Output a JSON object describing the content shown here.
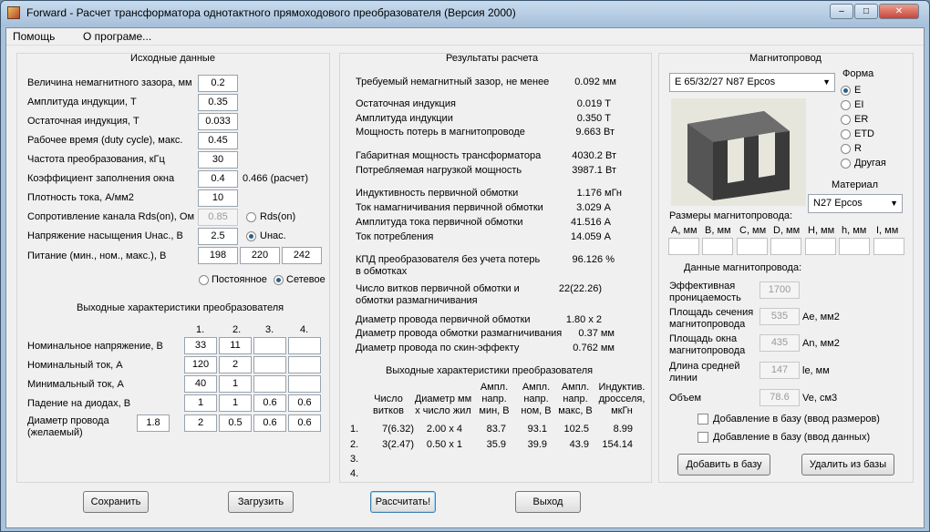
{
  "window": {
    "title": "Forward - Расчет трансформатора однотактного прямоходового преобразователя (Версия 2000)",
    "min_label": "–",
    "max_label": "□",
    "close_label": "✕"
  },
  "menu": {
    "help": "Помощь",
    "about": "О програме..."
  },
  "input": {
    "title": "Исходные данные",
    "rows": [
      {
        "label": "Величина немагнитного зазора, мм",
        "value": "0.2"
      },
      {
        "label": "Амплитуда индукции, Т",
        "value": "0.35"
      },
      {
        "label": "Остаточная индукция, Т",
        "value": "0.033"
      },
      {
        "label": "Рабочее время (duty cycle), макс.",
        "value": "0.45"
      },
      {
        "label": "Частота преобразования, кГц",
        "value": "30"
      },
      {
        "label": "Коэффициент заполнения окна",
        "value": "0.4"
      },
      {
        "label": "Плотность тока, А/мм2",
        "value": "10"
      },
      {
        "label": "Сопротивление канала Rds(on), Ом",
        "value": "0.85"
      },
      {
        "label": "Напряжение насыщения Uнас., В",
        "value": "2.5"
      }
    ],
    "fill_calc": "0.466 (расчет)",
    "radio_rds": "Rds(on)",
    "radio_usat": "Uнас.",
    "supply_label": "Питание (мин., ном., макс.), В",
    "supply": [
      "198",
      "220",
      "242"
    ],
    "radio_dc": "Постоянное",
    "radio_ac": "Сетевое"
  },
  "output_chars": {
    "title": "Выходные характеристики преобразователя",
    "columns": [
      "1.",
      "2.",
      "3.",
      "4."
    ],
    "rows": [
      {
        "label": "Номинальное напряжение, В",
        "values": [
          "33",
          "11",
          "",
          ""
        ]
      },
      {
        "label": "Номинальный ток, А",
        "values": [
          "120",
          "2",
          "",
          ""
        ]
      },
      {
        "label": "Минимальный ток, А",
        "values": [
          "40",
          "1",
          "",
          ""
        ]
      },
      {
        "label": "Падение на диодах, В",
        "values": [
          "1",
          "1",
          "0.6",
          "0.6"
        ]
      },
      {
        "label": "Диаметр провода (желаемый)",
        "values": [
          "2",
          "0.5",
          "0.6",
          "0.6"
        ]
      }
    ],
    "desired_wire": "1.8"
  },
  "results": {
    "title": "Результаты расчета",
    "rows": [
      {
        "label": "Требуемый немагнитный зазор, не менее",
        "value": "0.092 мм"
      },
      {
        "label": "Остаточная индукция",
        "value": "0.019 Т"
      },
      {
        "label": "Амплитуда индукции",
        "value": "0.350 Т"
      },
      {
        "label": "Мощность потерь в магнитопроводе",
        "value": "9.663 Вт"
      },
      {
        "label": "Габаритная мощность трансформатора",
        "value": "4030.2 Вт"
      },
      {
        "label": "Потребляемая нагрузкой мощность",
        "value": "3987.1 Вт"
      },
      {
        "label": "Индуктивность первичной обмотки",
        "value": "1.176 мГн"
      },
      {
        "label": "Ток намагничивания первичной обмотки",
        "value": "3.029 А"
      },
      {
        "label": "Амплитуда тока первичной обмотки",
        "value": "41.516 А"
      },
      {
        "label": "Ток потребления",
        "value": "14.059 А"
      },
      {
        "label": "КПД преобразователя без учета потерь в обмотках",
        "value": "96.126 %"
      },
      {
        "label": "Число витков первичной обмотки и обмотки размагничивания",
        "value": "22(22.26)"
      },
      {
        "label": "Диаметр провода первичной обмотки",
        "value": "1.80 x 2"
      },
      {
        "label": "Диаметр провода обмотки размагничивания",
        "value": "0.37 мм"
      },
      {
        "label": "Диаметр провода по скин-эффекту",
        "value": "0.762 мм"
      }
    ],
    "out_title": "Выходные характеристики преобразователя",
    "out_headers": [
      "Число витков",
      "Диаметр мм х число жил",
      "Ампл. напр. мин, В",
      "Ампл. напр. ном, В",
      "Ампл. напр. макс, В",
      "Индуктив. дросселя, мкГн"
    ],
    "out_rows": [
      {
        "n": "1.",
        "cells": [
          "7(6.32)",
          "2.00 x 4",
          "83.7",
          "93.1",
          "102.5",
          "8.99"
        ]
      },
      {
        "n": "2.",
        "cells": [
          "3(2.47)",
          "0.50 x 1",
          "35.9",
          "39.9",
          "43.9",
          "154.14"
        ]
      },
      {
        "n": "3.",
        "cells": [
          "",
          "",
          "",
          "",
          "",
          ""
        ]
      },
      {
        "n": "4.",
        "cells": [
          "",
          "",
          "",
          "",
          "",
          ""
        ]
      }
    ]
  },
  "core": {
    "title": "Магнитопровод",
    "selected": "E 65/32/27 N87 Epcos",
    "shape_title": "Форма",
    "shapes": [
      "E",
      "EI",
      "ER",
      "ETD",
      "R",
      "Другая"
    ],
    "material_title": "Материал",
    "material": "N27 Epcos",
    "dims_title": "Размеры магнитопровода:",
    "dims": [
      "A, мм",
      "B, мм",
      "C, мм",
      "D, мм",
      "H, мм",
      "h, мм",
      "I, мм"
    ],
    "data_title": "Данные магнитопровода:",
    "params": [
      {
        "label": "Эффективная проницаемость",
        "value": "1700",
        "unit": ""
      },
      {
        "label": "Площадь сечения магнитопровода",
        "value": "535",
        "unit": "Ae, мм2"
      },
      {
        "label": "Площадь окна магнитопровода",
        "value": "435",
        "unit": "An, мм2"
      },
      {
        "label": "Длина средней линии",
        "value": "147",
        "unit": "le, мм"
      },
      {
        "label": "Объем",
        "value": "78.6",
        "unit": "Ve, см3"
      }
    ],
    "chk_dims": "Добавление в базу (ввод размеров)",
    "chk_data": "Добавление в базу (ввод данных)",
    "add_btn": "Добавить в базу",
    "del_btn": "Удалить из базы"
  },
  "buttons": {
    "save": "Сохранить",
    "load": "Загрузить",
    "calc": "Рассчитать!",
    "exit": "Выход"
  }
}
